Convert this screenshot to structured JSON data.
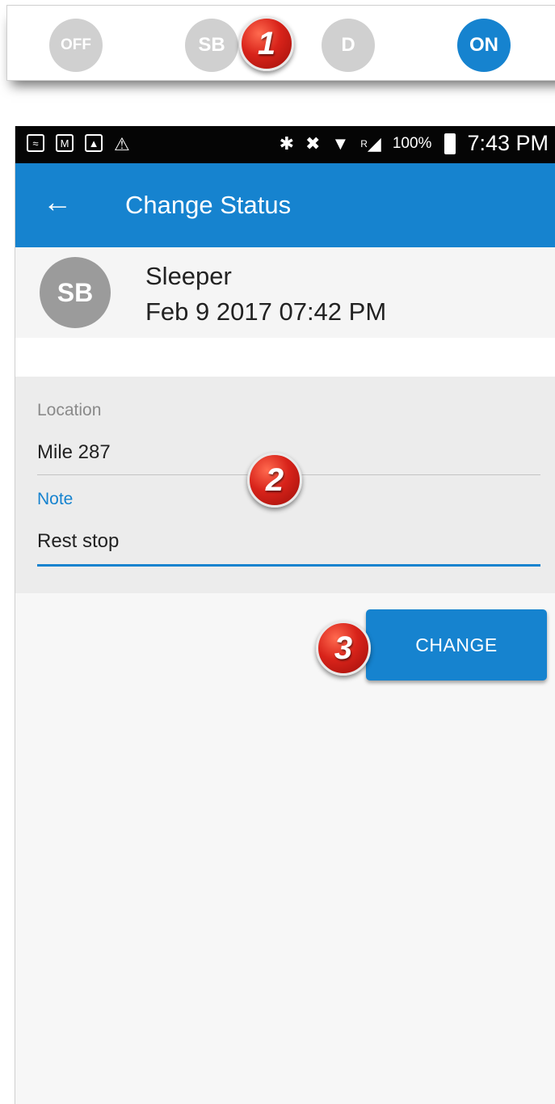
{
  "duty_status": {
    "off": "OFF",
    "sleeper": "SB",
    "driving": "D",
    "on_duty": "ON",
    "selected": "ON"
  },
  "callouts": [
    "1",
    "2",
    "3"
  ],
  "statusbar": {
    "left_icons": [
      "cast-icon",
      "gmail-icon",
      "image-icon",
      "warning-icon"
    ],
    "right_icons": [
      "bluetooth-icon",
      "mute-icon",
      "wifi-icon",
      "signal-roaming-icon",
      "battery-icon"
    ],
    "roaming": "R",
    "battery": "100%",
    "time": "7:43 PM"
  },
  "appbar": {
    "title": "Change Status"
  },
  "status_card": {
    "avatar": "SB",
    "name": "Sleeper",
    "timestamp": "Feb 9 2017 07:42 PM"
  },
  "form": {
    "location_label": "Location",
    "location_value": "Mile 287",
    "note_label": "Note",
    "note_value": "Rest stop"
  },
  "actions": {
    "change_label": "CHANGE"
  },
  "colors": {
    "primary": "#1683cf",
    "inactive_status": "#d0d0d0",
    "callout": "#d8231a"
  }
}
